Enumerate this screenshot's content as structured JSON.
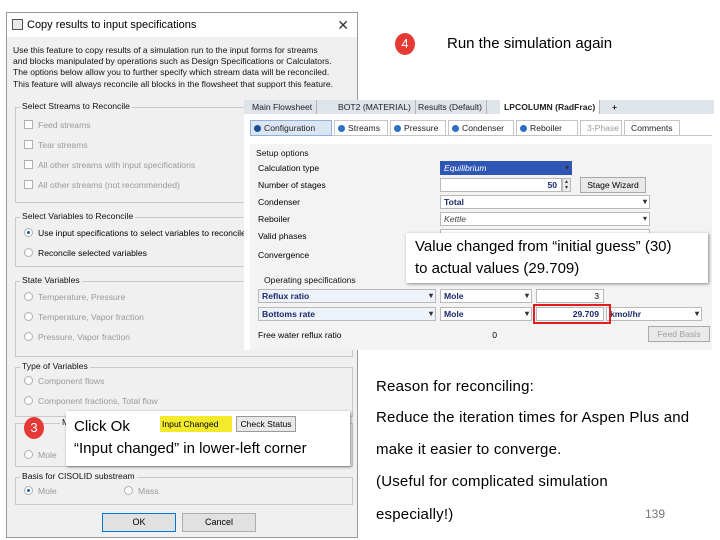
{
  "dialog": {
    "title": "Copy results to input specifications",
    "close_glyph": "✕",
    "description": [
      "Use this feature to copy results of a simulation run to the input forms for streams",
      "and blocks manipulated by operations such as Design Specifications or Calculators.",
      "The options below allow you to further specify which stream data will be reconciled.",
      "This feature will always reconcile all blocks in the flowsheet that support this feature."
    ],
    "streams_group": {
      "label": "Select Streams to Reconcile",
      "options": [
        {
          "label": "Feed streams",
          "checked": false
        },
        {
          "label": "Tear streams",
          "checked": false
        },
        {
          "label": "All other streams with input specifications",
          "checked": false
        },
        {
          "label": "All other streams (not recommended)",
          "checked": false
        }
      ]
    },
    "variables_group": {
      "label": "Select Variables to Reconcile",
      "options": [
        {
          "label": "Use input specifications to select variables to reconcile",
          "selected": true
        },
        {
          "label": "Reconcile selected variables",
          "selected": false
        }
      ]
    },
    "state_group": {
      "label": "State Variables",
      "options": [
        "Temperature, Pressure",
        "Temperature, Vapor fraction",
        "Pressure, Vapor fraction"
      ]
    },
    "type_group": {
      "label": "Type of Variables",
      "options": [
        "Component flows",
        "Component fractions, Total flow"
      ]
    },
    "mixed_group": {
      "partial_label": "MIX",
      "options": [
        "Mole"
      ]
    },
    "cisolid_group": {
      "label": "Basis for CISOLID substream",
      "options": [
        {
          "label": "Mole",
          "selected": true
        },
        {
          "label": "Mass",
          "selected": false
        }
      ]
    },
    "ok_label": "OK",
    "cancel_label": "Cancel",
    "status_strip": {
      "input_changed": "Input Changed",
      "check_status": "Check Status",
      "highlight_color": "#f2ea2b"
    }
  },
  "aspen": {
    "doc_tabs": [
      "Main Flowsheet",
      "BOT2 (MATERIAL)",
      "Results (Default)",
      "LPCOLUMN (RadFrac)",
      "+"
    ],
    "active_doc_tab": "LPCOLUMN (RadFrac)",
    "form_tabs": [
      "Configuration",
      "Streams",
      "Pressure",
      "Condenser",
      "Reboiler",
      "3-Phase",
      "Comments"
    ],
    "active_form_tab": "Configuration",
    "setup_section": "Setup options",
    "setup_rows": [
      {
        "label": "Calculation type",
        "value": "Equilibrium"
      },
      {
        "label": "Number of stages",
        "value": "50"
      },
      {
        "label": "Condenser",
        "value": "Total"
      },
      {
        "label": "Reboiler",
        "value": "Kettle"
      },
      {
        "label": "Valid phases",
        "value": ""
      },
      {
        "label": "Convergence",
        "value": ""
      }
    ],
    "stage_wizard_label": "Stage Wizard",
    "operating_section": "Operating specifications",
    "op_rows": [
      {
        "label": "Reflux ratio",
        "basis": "Mole",
        "value": "3",
        "units": ""
      },
      {
        "label": "Bottoms rate",
        "basis": "Mole",
        "value": "29.709",
        "units": "kmol/hr"
      }
    ],
    "free_water_label": "Free water reflux ratio",
    "free_water_value": "0",
    "feed_basis_label": "Feed Basis",
    "accent_color": "#2f56b5",
    "highlight_box_color": "#e11d1d"
  },
  "annotations": {
    "step3_number": "3",
    "step3_line1": "Click Ok",
    "step3_line2": "“Input changed” in lower-left corner",
    "step4_number": "4",
    "step4_text": "Run the simulation again",
    "value_change_line1": "Value changed from “initial guess” (30)",
    "value_change_line2": "to actual values (29.709)",
    "reason_title": "Reason for reconciling:",
    "reason_lines": [
      "Reduce the iteration times for Aspen Plus and",
      "make it easier to converge.",
      "(Useful for complicated simulation",
      "especially!)"
    ],
    "badge_color": "#e53935"
  },
  "page_number": "139"
}
